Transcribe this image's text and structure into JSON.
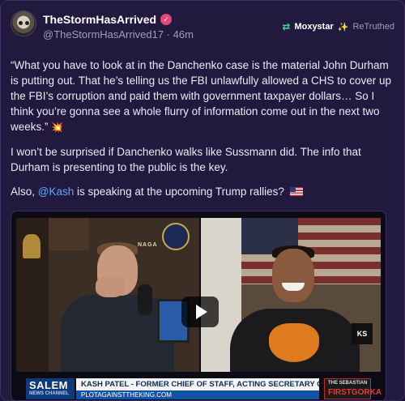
{
  "post": {
    "display_name": "TheStormHasArrived",
    "handle": "@TheStormHasArrived17",
    "separator": "·",
    "time_ago": "46m",
    "verified_badge_icon": "verified-check-icon",
    "avatar_icon": "skull-avatar"
  },
  "retruth": {
    "icon": "retruth-arrows-icon",
    "user": "Moxystar",
    "user_emoji": "✨",
    "label": "ReTruthed"
  },
  "body": {
    "para1": "“What you have to look at in the Danchenko case is the material John Durham is putting out. That he’s telling us the FBI unlawfully allowed a CHS to cover up the FBI’s corruption and paid them with government taxpayer dollars… So I think you’re gonna see a whole flurry of information come out in the next two weeks.”",
    "para1_emoji": "💥",
    "para2": "I won’t be surprised if Danchenko walks like Sussmann did. The info that Durham is presenting to the public is the key.",
    "para3_prefix": "Also,",
    "para3_mention": "@Kash",
    "para3_suffix": "is speaking at the upcoming Trump rallies?",
    "para3_flag_icon": "us-flag-icon"
  },
  "video": {
    "play_icon": "play-icon",
    "network_name": "SALEM",
    "network_sub": "NEWS CHANNEL",
    "chyron_main": "KASH PATEL - FORMER CHIEF OF STAFF, ACTING SECRETARY OF DEFENSE",
    "chyron_sub": "PLOTAGAINSTTHEKING.COM",
    "show_logo_top": "THE SEBASTIAN",
    "show_logo_main": "FIRSTGORKA",
    "seal_label": "NAGA",
    "sign_label": "KS"
  },
  "colors": {
    "background": "#221a3e",
    "mention": "#5aa8ff",
    "verified": "#e8457a",
    "retruth_icon": "#3ddc84"
  }
}
